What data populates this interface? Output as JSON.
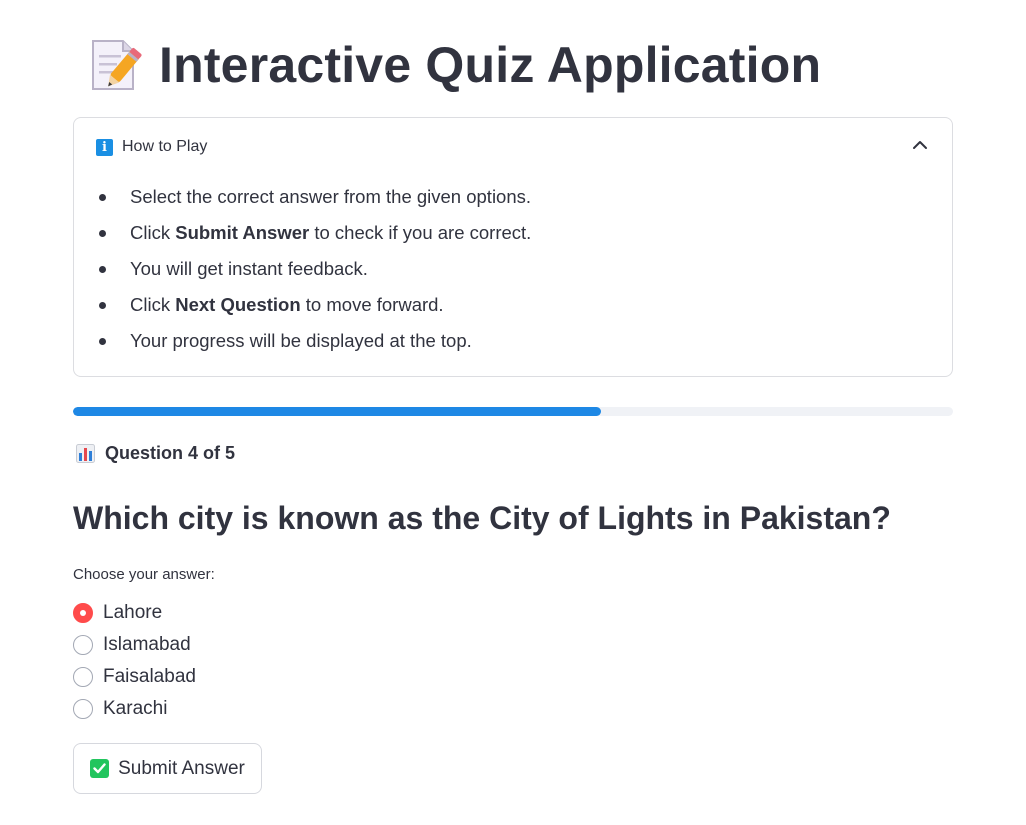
{
  "header": {
    "title": "Interactive Quiz Application",
    "icon": "memo-pencil-icon"
  },
  "how_to_play": {
    "title": "How to Play",
    "icon": "info-icon",
    "expanded": true,
    "items": [
      {
        "pre": "Select the correct answer from the given options.",
        "bold": "",
        "post": ""
      },
      {
        "pre": "Click ",
        "bold": "Submit Answer",
        "post": " to check if you are correct."
      },
      {
        "pre": "You will get instant feedback.",
        "bold": "",
        "post": ""
      },
      {
        "pre": "Click ",
        "bold": "Next Question",
        "post": " to move forward."
      },
      {
        "pre": "Your progress will be displayed at the top.",
        "bold": "",
        "post": ""
      }
    ]
  },
  "progress": {
    "value": 0.6,
    "color": "#1e88e5"
  },
  "question_counter": {
    "text": "Question 4 of 5",
    "icon": "bar-chart-icon"
  },
  "question": {
    "text": "Which city is known as the City of Lights in Pakistan?"
  },
  "answers": {
    "label": "Choose your answer:",
    "options": [
      "Lahore",
      "Islamabad",
      "Faisalabad",
      "Karachi"
    ],
    "selected": "Lahore",
    "accent": "#ff4b4b"
  },
  "submit": {
    "label": "Submit Answer",
    "icon": "check-mark-button-icon"
  }
}
